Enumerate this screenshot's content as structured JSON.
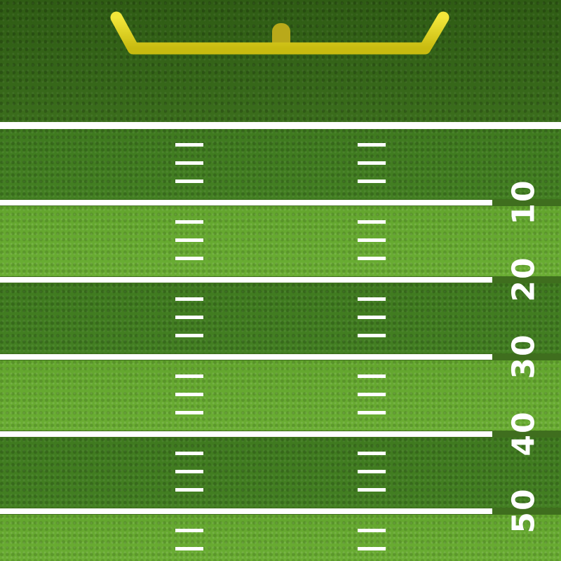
{
  "field": {
    "yard_numbers": [
      "10",
      "20",
      "30",
      "40",
      "50"
    ]
  },
  "colors": {
    "endzone": "#346418",
    "stripe_dark": "#427e21",
    "stripe_light": "#67aa31",
    "lines": "#ffffff",
    "goalpost": "#e5d817"
  }
}
